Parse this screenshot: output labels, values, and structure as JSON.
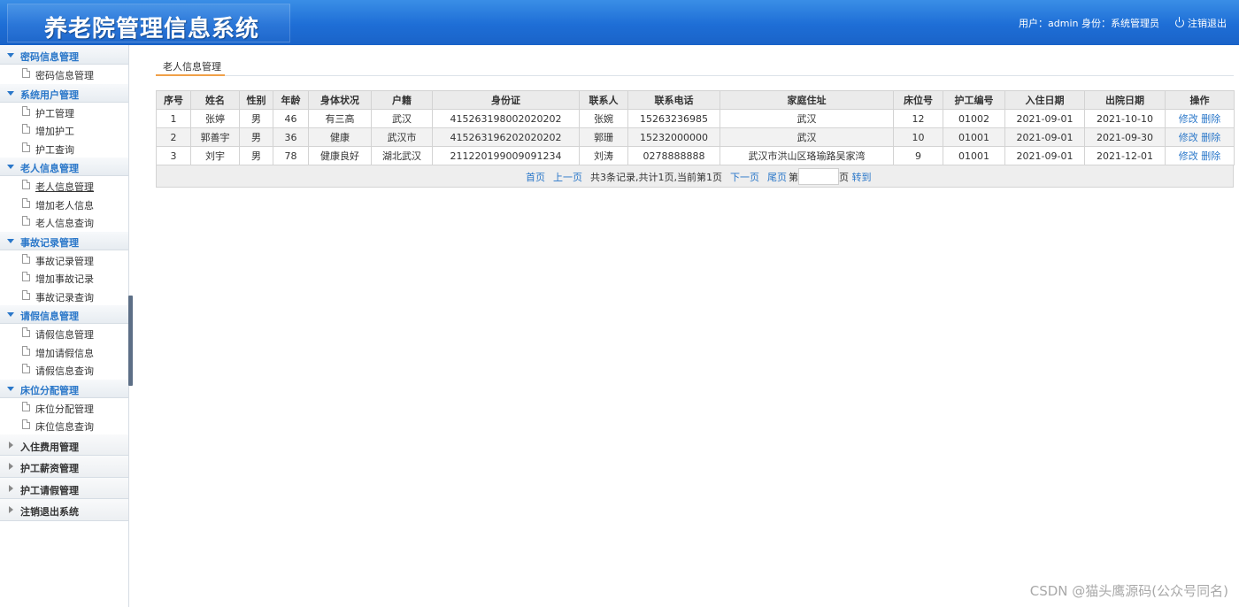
{
  "header": {
    "title": "养老院管理信息系统",
    "user_info": "用户：admin 身份：系统管理员",
    "logout_label": "注销退出"
  },
  "sidebar": {
    "groups": [
      {
        "title": "密码信息管理",
        "items": [
          "密码信息管理"
        ]
      },
      {
        "title": "系统用户管理",
        "items": [
          "护工管理",
          "增加护工",
          "护工查询"
        ]
      },
      {
        "title": "老人信息管理",
        "items": [
          "老人信息管理",
          "增加老人信息",
          "老人信息查询"
        ]
      },
      {
        "title": "事故记录管理",
        "items": [
          "事故记录管理",
          "增加事故记录",
          "事故记录查询"
        ]
      },
      {
        "title": "请假信息管理",
        "items": [
          "请假信息管理",
          "增加请假信息",
          "请假信息查询"
        ]
      },
      {
        "title": "床位分配管理",
        "items": [
          "床位分配管理",
          "床位信息查询"
        ]
      }
    ],
    "collapsed": [
      "入住费用管理",
      "护工薪资管理",
      "护工请假管理",
      "注销退出系统"
    ]
  },
  "main": {
    "tab_label": "老人信息管理",
    "columns": [
      "序号",
      "姓名",
      "性别",
      "年龄",
      "身体状况",
      "户籍",
      "身份证",
      "联系人",
      "联系电话",
      "家庭住址",
      "床位号",
      "护工编号",
      "入住日期",
      "出院日期",
      "操作"
    ],
    "rows": [
      [
        "1",
        "张婷",
        "男",
        "46",
        "有三高",
        "武汉",
        "415263198002020202",
        "张婉",
        "15263236985",
        "武汉",
        "12",
        "01002",
        "2021-09-01",
        "2021-10-10"
      ],
      [
        "2",
        "郭善宇",
        "男",
        "36",
        "健康",
        "武汉市",
        "415263196202020202",
        "郭珊",
        "15232000000",
        "武汉",
        "10",
        "01001",
        "2021-09-01",
        "2021-09-30"
      ],
      [
        "3",
        "刘宇",
        "男",
        "78",
        "健康良好",
        "湖北武汉",
        "211220199009091234",
        "刘涛",
        "0278888888",
        "武汉市洪山区珞瑜路吴家湾",
        "9",
        "01001",
        "2021-09-01",
        "2021-12-01"
      ]
    ],
    "edit_label": "修改",
    "delete_label": "删除",
    "pager": {
      "first": "首页",
      "prev": "上一页",
      "info": "共3条记录,共计1页,当前第1页",
      "next": "下一页",
      "last": "尾页",
      "page_prefix": "第",
      "page_suffix": "页",
      "go": "转到"
    }
  },
  "watermark": "CSDN @猫头鹰源码(公众号同名)",
  "colors": {
    "header": "#1e6ed6",
    "accent": "#2a77c9",
    "tab_underline": "#f0a048"
  }
}
